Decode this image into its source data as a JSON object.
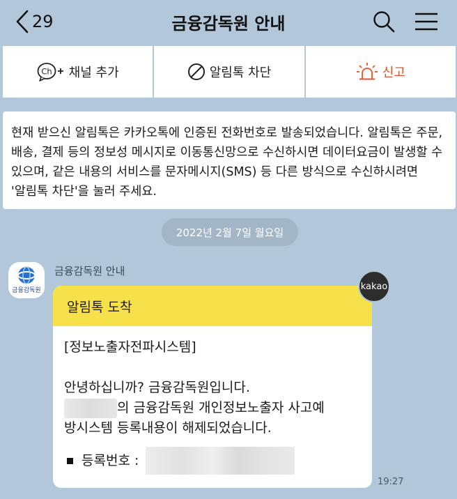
{
  "header": {
    "back_count": "29",
    "title": "금융감독원 안내"
  },
  "actions": {
    "add_channel": "채널 추가",
    "block": "알림톡 차단",
    "report": "신고"
  },
  "notice": {
    "text": "현재 받으신 알림톡은 카카오톡에 인증된 전화번호로 발송되었습니다. 알림톡은 주문, 배송, 결제 등의 정보성 메시지로 이동통신망으로 수신하시면 데이터요금이 발생할 수 있으며, 같은 내용의 서비스를 문자메시지(SMS) 등 다른 방식으로 수신하시려면 '알림톡 차단'을 눌러 주세요."
  },
  "date_divider": "2022년 2월 7일 월요일",
  "sender": {
    "name": "금융감독원 안내",
    "avatar_label": "금융감독원"
  },
  "message": {
    "header": "알림톡 도착",
    "line1": "[정보노출자전파시스템]",
    "line2": "안녕하십니까? 금융감독원입니다.",
    "line3": "의 금융감독원 개인정보노출자 사고예",
    "line4": "방시스템 등록내용이 해제되었습니다.",
    "reg_label": "등록번호 :",
    "badge": "kakao",
    "time": "19:27"
  },
  "colors": {
    "background": "#b2c7da",
    "card_header": "#f7e14b",
    "report": "#e0552a"
  },
  "icons": {
    "back": "chevron-left-icon",
    "search": "search-icon",
    "menu": "hamburger-menu-icon",
    "channel": "ch-plus-icon",
    "block": "prohibited-icon",
    "report": "siren-icon"
  }
}
